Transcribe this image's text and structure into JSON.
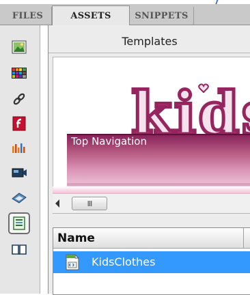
{
  "tabs": [
    {
      "label": "FILES"
    },
    {
      "label": "ASSETS"
    },
    {
      "label": "SNIPPETS"
    }
  ],
  "active_tab": "ASSETS",
  "category": {
    "title": "Templates"
  },
  "preview": {
    "logo_text": "kids",
    "region_label": "Top Navigation"
  },
  "scrollbar": {
    "thumb_grip": "III"
  },
  "list": {
    "column_header": "Name",
    "items": [
      {
        "name": "KidsClothes",
        "selected": true
      }
    ]
  },
  "sidebar_icons": [
    "images-icon",
    "colors-icon",
    "urls-icon",
    "flash-icon",
    "shockwave-icon",
    "movies-icon",
    "scripts-icon",
    "templates-icon",
    "library-icon"
  ],
  "colors": {
    "selection": "#3399ff",
    "brand_magenta": "#96245e"
  }
}
